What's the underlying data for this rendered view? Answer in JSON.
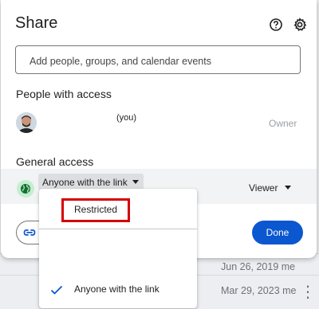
{
  "background": {
    "rows": [
      {
        "date": "Jun 26, 2019 me"
      },
      {
        "date": "Mar 29, 2023 me"
      }
    ]
  },
  "dialog": {
    "title": "Share",
    "icons": {
      "help": "help-icon",
      "settings": "gear-icon"
    },
    "add_input_placeholder": "Add people, groups, and calendar events",
    "people_section_label": "People with access",
    "person": {
      "name": "(you)",
      "role": "Owner",
      "avatar": "avatar"
    },
    "general_section_label": "General access",
    "general_access": {
      "selected": "Anyone with the link",
      "role": "Viewer",
      "globe_color": "#c4eed0"
    },
    "done_label": "Done",
    "accent_color": "#0b57d0"
  },
  "access_menu": {
    "items": [
      {
        "label": "Restricted",
        "highlighted": true,
        "checked": false
      },
      {
        "label": "",
        "checked": false
      },
      {
        "label": "Anyone with the link",
        "checked": true
      }
    ],
    "highlight_color": "#d50000"
  }
}
